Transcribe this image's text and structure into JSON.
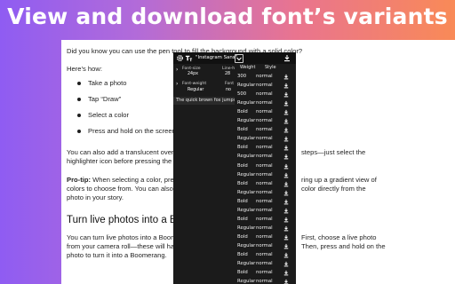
{
  "banner": {
    "title": "View and download font’s variants"
  },
  "article": {
    "intro": "Did you know you can use the pen tool to fill the background with a solid color?",
    "heres_how": "Here’s how:",
    "steps": [
      "Take a photo",
      "Tap “Draw”",
      "Select a color",
      "Press and hold on the screen to fill"
    ],
    "overlay_text": "You can also add a translucent overlay to your story by",
    "overlay_text_right": "steps—just select the",
    "overlay_text2": "highlighter icon before pressing the screen to fill.",
    "protip_label": "Pro-tip:",
    "protip_text": " When selecting a color, press and hold on the",
    "protip_right": "ring up a gradient view of",
    "protip_line2": "colors to choose from. You can also tap the eyedropper",
    "protip_line2_right": "color directly from the",
    "protip_line3": "photo in your story.",
    "boomerang_heading": "Turn live photos into a Boomerang",
    "boomerang_line1": "You can turn live photos into a Boomerang on your stor",
    "boomerang_line1_right": "First, choose a live photo",
    "boomerang_line2": "from your camera roll—these will have the boomerang ic",
    "boomerang_line2_right": "Then, press and hold on the",
    "boomerang_line3": "photo to turn it into a Boomerang."
  },
  "panel": {
    "font_name": "\"Instagram Sans\"",
    "font_size_label": "Font-size",
    "font_size_value": "24px",
    "line_height_label": "Line-h",
    "line_height_value": "28",
    "font_weight_label": "Font-weight",
    "font_weight_value": "Regular",
    "font_style_label": "Font",
    "font_style_value": "no",
    "preview_text": "The quick brown fox jumps",
    "columns": {
      "weight": "Weight",
      "style": "Style"
    },
    "variants": [
      {
        "weight": "300",
        "style": "normal"
      },
      {
        "weight": "Regular",
        "style": "normal"
      },
      {
        "weight": "500",
        "style": "normal"
      },
      {
        "weight": "Regular",
        "style": "normal"
      },
      {
        "weight": "Bold",
        "style": "normal"
      },
      {
        "weight": "Regular",
        "style": "normal"
      },
      {
        "weight": "Bold",
        "style": "normal"
      },
      {
        "weight": "Regular",
        "style": "normal"
      },
      {
        "weight": "Bold",
        "style": "normal"
      },
      {
        "weight": "Regular",
        "style": "normal"
      },
      {
        "weight": "Bold",
        "style": "normal"
      },
      {
        "weight": "Regular",
        "style": "normal"
      },
      {
        "weight": "Bold",
        "style": "normal"
      },
      {
        "weight": "Regular",
        "style": "normal"
      },
      {
        "weight": "Bold",
        "style": "normal"
      },
      {
        "weight": "Regular",
        "style": "normal"
      },
      {
        "weight": "Bold",
        "style": "normal"
      },
      {
        "weight": "Regular",
        "style": "normal"
      },
      {
        "weight": "Bold",
        "style": "normal"
      },
      {
        "weight": "Regular",
        "style": "normal"
      },
      {
        "weight": "Bold",
        "style": "normal"
      },
      {
        "weight": "Regular",
        "style": "normal"
      },
      {
        "weight": "Bold",
        "style": "normal"
      },
      {
        "weight": "Regular",
        "style": "normal"
      }
    ]
  },
  "icons": {
    "settings": "gear-icon",
    "text": "text-style-icon",
    "expand": "chevron-down-icon",
    "download": "download-icon"
  },
  "colors": {
    "gradient_start": "#8f5cf2",
    "gradient_end": "#f98a57",
    "panel_bg": "#1b1b1b",
    "text": "#1f1f1f"
  }
}
